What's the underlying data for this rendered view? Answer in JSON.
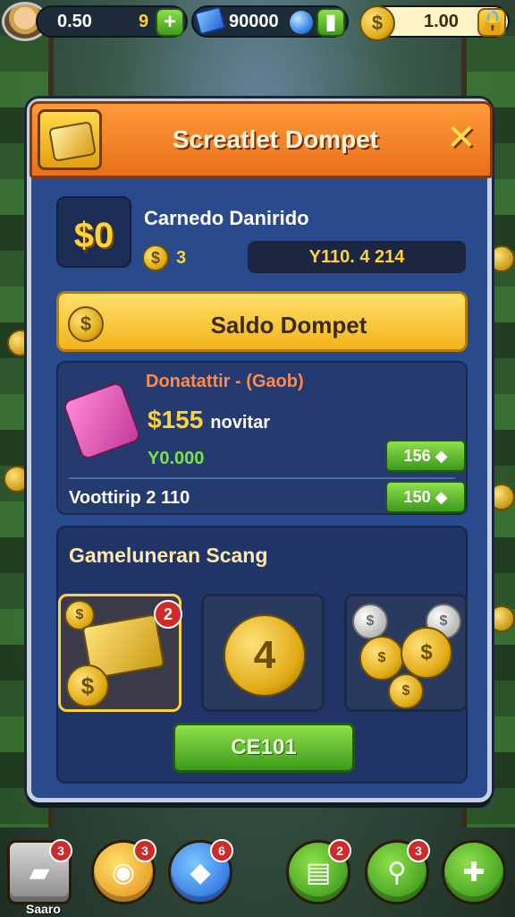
{
  "topbar": {
    "stat_1_a": "0.50",
    "stat_1_b": "9",
    "stat_2": "90000",
    "stat_3": "1.00",
    "plus_label": "+"
  },
  "modal": {
    "title": "Screatlet Dompet",
    "close_label": "✕"
  },
  "balance": {
    "icon_text": "$0",
    "player_name": "Carnedo Danirido",
    "coin_count": "3",
    "value": "Y110. 4 214"
  },
  "saldo_button": {
    "label": "Saldo Dompet",
    "coin_glyph": "$"
  },
  "donation": {
    "title": "Donatattir - (Gaob)",
    "price": "$155",
    "price_suffix": "novitar",
    "sub_amount": "Y0.000",
    "button_1": "156 ◆",
    "limit_label": "Voottirip 2 110",
    "button_2": "150 ◆"
  },
  "shop": {
    "title": "Gameluneran Scang",
    "item_1_badge": "2",
    "item_2_value": "4",
    "collect_label": "CE101"
  },
  "bottombar": {
    "item_1_label": "Saaro",
    "badge_1": "3",
    "badge_2": "3",
    "badge_3": "6",
    "badge_4": "2",
    "badge_5": "3"
  },
  "colors": {
    "header_orange": "#f08a2a",
    "panel_blue": "#2a4a8e",
    "gold": "#ffd23a",
    "green": "#5bbf2a"
  }
}
